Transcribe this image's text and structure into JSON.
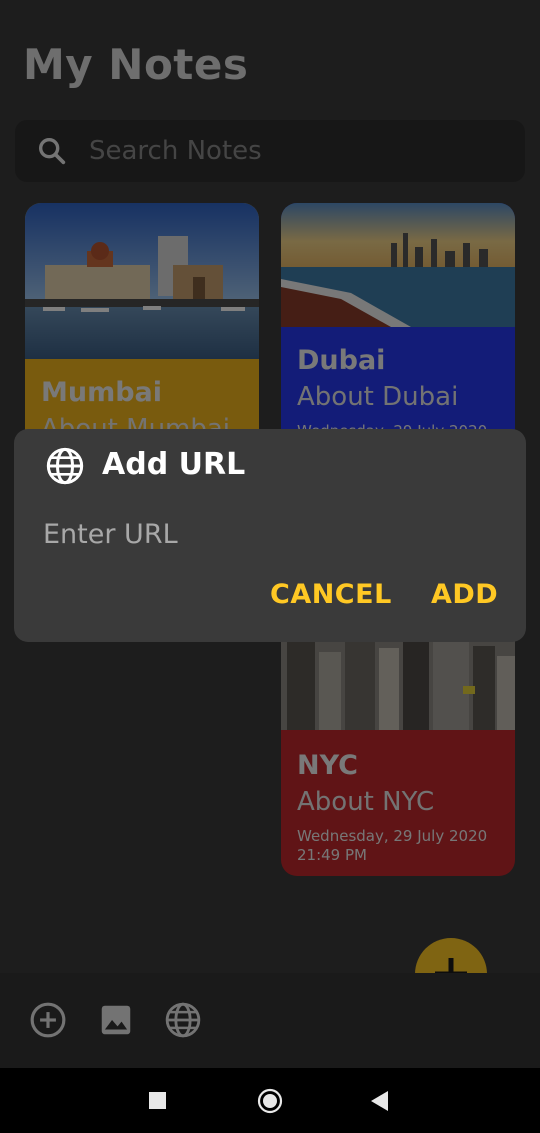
{
  "header": {
    "title": "My Notes"
  },
  "search": {
    "placeholder": "Search Notes"
  },
  "notes": [
    {
      "title": "Mumbai",
      "subtitle": "About Mumbai",
      "date": "",
      "color": "#f3b71c"
    },
    {
      "title": "Dubai",
      "subtitle": "About Dubai",
      "date": "Wednesday, 29 July 2020",
      "color": "#2739f1"
    },
    {
      "title": "NYC",
      "subtitle": "About NYC",
      "date": "Wednesday, 29 July 2020",
      "time": "21:49 PM",
      "color": "#c0282c"
    }
  ],
  "dialog": {
    "title": "Add URL",
    "input_placeholder": "Enter URL",
    "cancel_label": "CANCEL",
    "add_label": "ADD"
  },
  "bottom_bar": {
    "icons": [
      "add-circle-icon",
      "image-icon",
      "globe-icon"
    ]
  },
  "fab": {
    "icon": "plus-icon",
    "color": "#ffc824"
  },
  "accent_color": "#ffc824"
}
